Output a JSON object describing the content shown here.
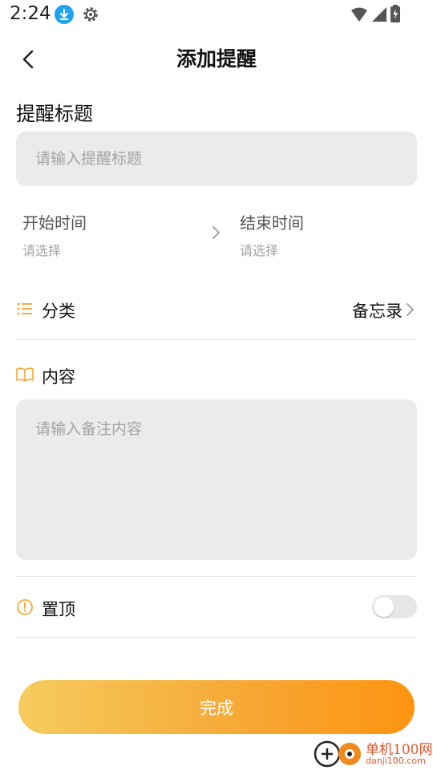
{
  "status_bar": {
    "time": "2:24"
  },
  "header": {
    "title": "添加提醒"
  },
  "title_section": {
    "label": "提醒标题",
    "placeholder": "请输入提醒标题"
  },
  "time_section": {
    "start": {
      "label": "开始时间",
      "value": "请选择"
    },
    "end": {
      "label": "结束时间",
      "value": "请选择"
    }
  },
  "category": {
    "label": "分类",
    "value": "备忘录"
  },
  "content": {
    "label": "内容",
    "placeholder": "请输入备注内容"
  },
  "pin": {
    "label": "置顶",
    "enabled": false
  },
  "done_button": {
    "label": "完成"
  },
  "watermark": {
    "name": "单机100网",
    "url": "danji100.com"
  },
  "colors": {
    "accent": "#f7a633",
    "input_bg": "#ebebeb",
    "download_badge": "#1fa3f0",
    "button_gradient_start": "#f5cb5e",
    "button_gradient_end": "#fe9410"
  },
  "icons": {
    "back": "chevron-left-icon",
    "time_arrow": "chevron-right-icon",
    "category": "list-icon",
    "category_arrow": "chevron-right-icon",
    "content": "book-icon",
    "pin": "arrow-up-circle-icon"
  }
}
